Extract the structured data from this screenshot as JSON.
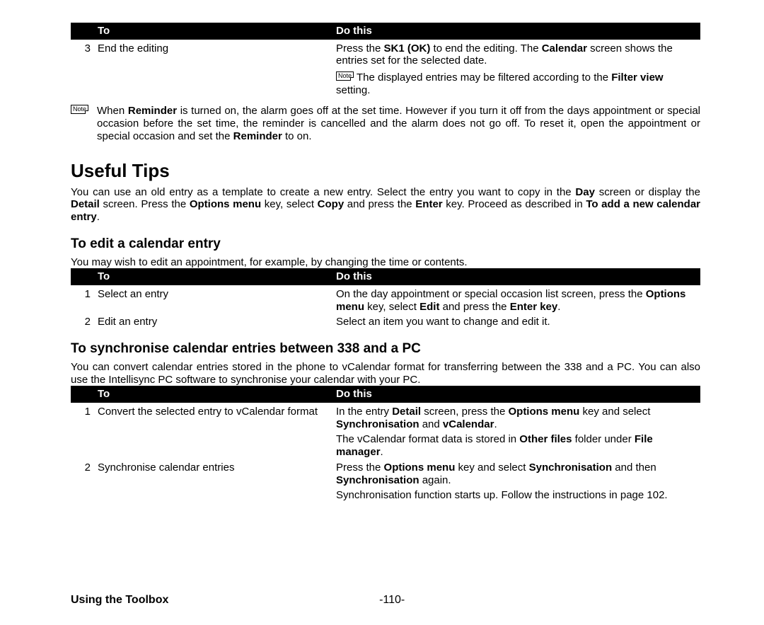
{
  "headers": {
    "to": "To",
    "do": "Do this"
  },
  "table1": {
    "rows": [
      {
        "n": "3",
        "to": "End the editing",
        "do_pre": "Press the ",
        "do_b1": "SK1 (OK)",
        "do_mid": " to end the editing. The ",
        "do_b2": "Calendar",
        "do_post": " screen shows the entries set for the selected date."
      }
    ],
    "note": {
      "icon": "Note",
      "pre": "The displayed entries may be filtered according to the ",
      "b": "Filter view",
      "post": " setting."
    }
  },
  "globalNote": {
    "icon": "Note",
    "t1": "When ",
    "b1": "Reminder",
    "t2": " is turned on, the alarm goes off at the set time. However if you turn it off from the days appointment or special occasion before the set time, the reminder is cancelled and the alarm does not go off. To reset it, open the appointment or special occasion and set the ",
    "b2": "Reminder",
    "t3": " to on."
  },
  "tipsHeading": "Useful Tips",
  "tipsPara": {
    "t1": "You can use an old entry as a template to create a new entry. Select the entry you want to copy in the ",
    "b1": "Day",
    "t2": " screen or display the ",
    "b2": "Detail",
    "t3": " screen. Press the ",
    "b3": "Options menu",
    "t4": " key, select ",
    "b4": "Copy",
    "t5": " and press the ",
    "b5": "Enter",
    "t6": " key. Proceed as described in ",
    "b6": "To add a new calendar entry",
    "t7": "."
  },
  "editHeading": "To edit a calendar entry",
  "editIntro": "You may wish to edit an appointment, for example, by changing the time or contents.",
  "table2": {
    "rows": [
      {
        "n": "1",
        "to": "Select an entry",
        "do_t1": "On the day appointment or special occasion list screen, press the ",
        "do_b1": "Options menu",
        "do_t2": " key, select ",
        "do_b2": "Edit",
        "do_t3": " and press the ",
        "do_b3": "Enter key",
        "do_t4": "."
      },
      {
        "n": "2",
        "to": "Edit an entry",
        "do_plain": "Select an item you want to change and edit it."
      }
    ]
  },
  "syncHeading": "To synchronise calendar entries between 338 and a PC",
  "syncIntro": "You can convert calendar entries stored in the phone to vCalendar format for transferring between the 338 and a PC. You can also use the Intellisync PC software to synchronise your calendar with your PC.",
  "table3": {
    "rows": [
      {
        "n": "1",
        "to": "Convert the selected entry to vCalendar format",
        "p1_t1": "In the entry ",
        "p1_b1": "Detail",
        "p1_t2": " screen, press the ",
        "p1_b2": "Options menu",
        "p1_t3": " key and select ",
        "p1_b3": "Synchronisation",
        "p1_t4": " and ",
        "p1_b4": "vCalendar",
        "p1_t5": ".",
        "p2_t1": "The vCalendar format data is stored in ",
        "p2_b1": "Other files",
        "p2_t2": " folder under ",
        "p2_b2": "File manager",
        "p2_t3": "."
      },
      {
        "n": "2",
        "to": "Synchronise calendar entries",
        "p1_t1": "Press the ",
        "p1_b1": "Options menu",
        "p1_t2": " key and select ",
        "p1_b2": "Synchronisation",
        "p1_t3": " and then ",
        "p1_b3": "Synchronisation",
        "p1_t4": " again.",
        "p2_plain": "Synchronisation function starts up. Follow the instructions in page 102."
      }
    ]
  },
  "footer": {
    "left": "Using the Toolbox",
    "page": "-110-"
  }
}
